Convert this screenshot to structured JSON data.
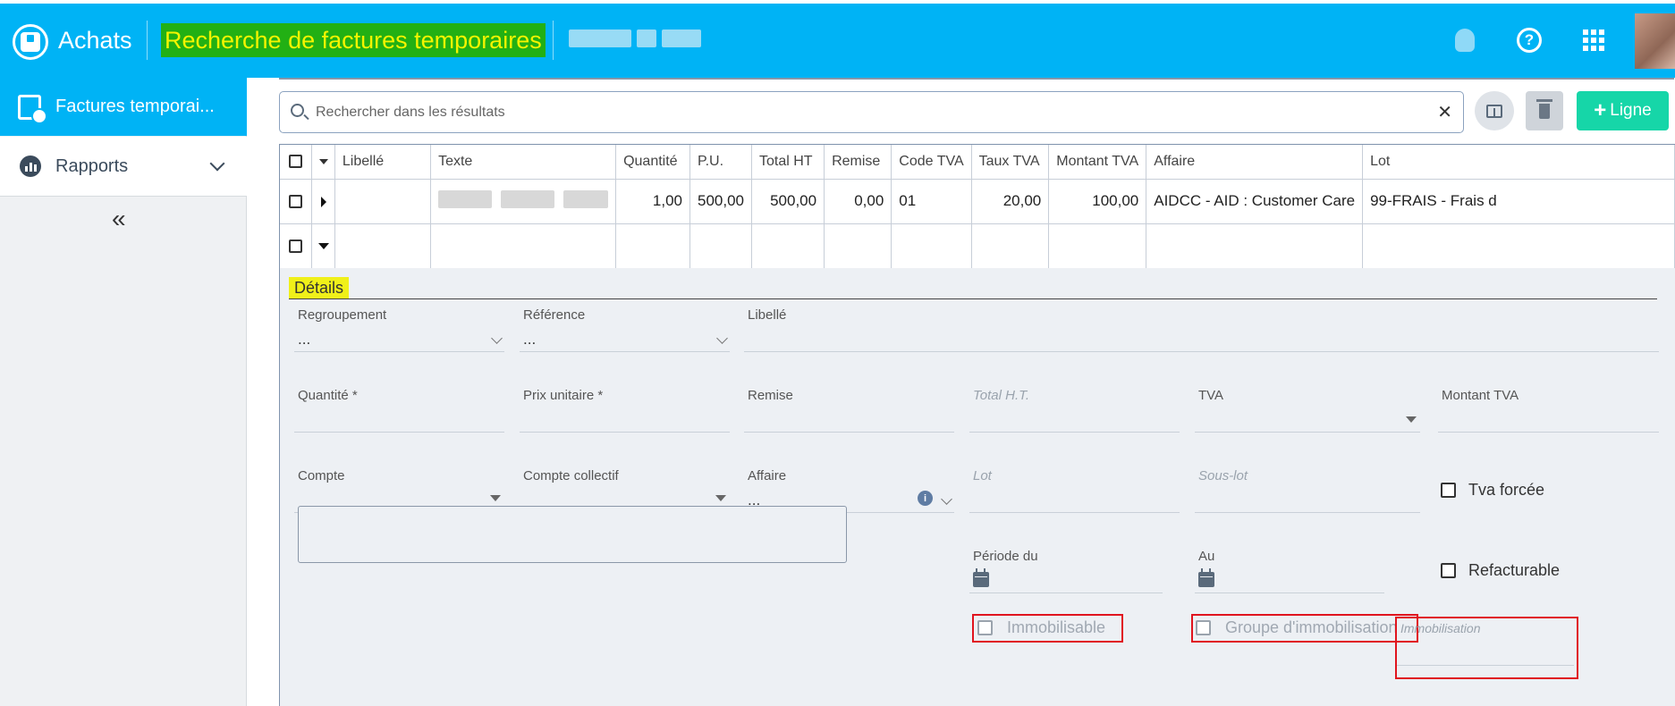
{
  "header": {
    "app_name": "Achats",
    "page_title": "Recherche de factures temporaires",
    "icons": [
      "home-icon",
      "lightbulb-icon",
      "help-icon",
      "apps-grid-icon",
      "user-avatar"
    ],
    "colors": {
      "bar": "#00b3f5",
      "title_bg": "#22b014",
      "title_text": "#f4f400"
    }
  },
  "sidebar": {
    "items": [
      {
        "label": "Factures temporai...",
        "icon": "invoice-clock-icon",
        "active": true
      },
      {
        "label": "Rapports",
        "icon": "chart-icon",
        "active": false
      }
    ],
    "collapse_label": "«"
  },
  "toolbar": {
    "search_placeholder": "Rechercher dans les résultats",
    "clear_label": "✕",
    "add_label": "Ligne",
    "add_color": "#16d6a8"
  },
  "grid": {
    "columns": [
      "Libellé",
      "Texte",
      "Quantité",
      "P.U.",
      "Total HT",
      "Remise",
      "Code TVA",
      "Taux TVA",
      "Montant TVA",
      "Affaire",
      "Lot"
    ],
    "rows": [
      {
        "libelle": "",
        "quantite": "1,00",
        "pu": "500,00",
        "total_ht": "500,00",
        "remise": "0,00",
        "code_tva": "01",
        "taux_tva": "20,00",
        "montant_tva": "100,00",
        "affaire": "AIDCC - AID : Customer Care",
        "lot": "99-FRAIS - Frais d"
      }
    ]
  },
  "details": {
    "title": "Détails",
    "regroupement": {
      "label": "Regroupement",
      "value": "..."
    },
    "reference": {
      "label": "Référence",
      "value": "..."
    },
    "libelle": {
      "label": "Libellé"
    },
    "quantite": {
      "label": "Quantité *"
    },
    "prix_unitaire": {
      "label": "Prix unitaire *"
    },
    "remise": {
      "label": "Remise"
    },
    "total_ht": {
      "label": "Total H.T."
    },
    "tva": {
      "label": "TVA"
    },
    "montant_tva": {
      "label": "Montant TVA"
    },
    "compte": {
      "label": "Compte"
    },
    "compte_collectif": {
      "label": "Compte collectif"
    },
    "affaire": {
      "label": "Affaire",
      "value": "..."
    },
    "lot": {
      "label": "Lot"
    },
    "sous_lot": {
      "label": "Sous-lot"
    },
    "tva_forcee": {
      "label": "Tva forcée",
      "checked": false
    },
    "periode_du": {
      "label": "Période du"
    },
    "au": {
      "label": "Au"
    },
    "refacturable": {
      "label": "Refacturable",
      "checked": false
    },
    "immobilisable": {
      "label": "Immobilisable",
      "checked": false
    },
    "groupe_immobilisation": {
      "label": "Groupe d'immobilisation",
      "checked": false
    },
    "immobilisation": {
      "label": "Immobilisation"
    }
  }
}
